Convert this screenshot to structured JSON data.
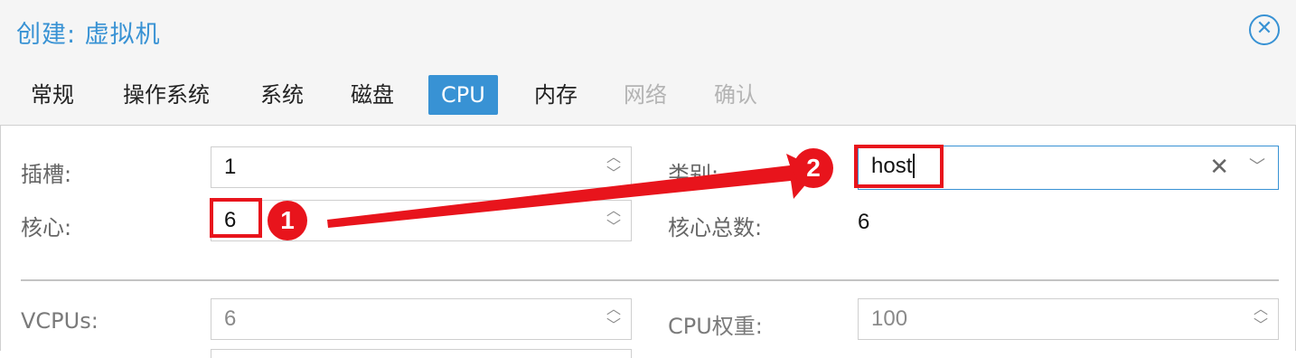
{
  "window": {
    "title": "创建: 虚拟机"
  },
  "tabs": [
    {
      "label": "常规",
      "state": "normal"
    },
    {
      "label": "操作系统",
      "state": "normal"
    },
    {
      "label": "系统",
      "state": "normal"
    },
    {
      "label": "磁盘",
      "state": "normal"
    },
    {
      "label": "CPU",
      "state": "active"
    },
    {
      "label": "内存",
      "state": "normal"
    },
    {
      "label": "网络",
      "state": "disabled"
    },
    {
      "label": "确认",
      "state": "disabled"
    }
  ],
  "cpu": {
    "sockets": {
      "label": "插槽:",
      "value": "1"
    },
    "cores": {
      "label": "核心:",
      "value": "6"
    },
    "type": {
      "label": "类别:",
      "value": "host"
    },
    "total_cores": {
      "label": "核心总数:",
      "value": "6"
    },
    "vcpus": {
      "label": "VCPUs:",
      "value": "6"
    },
    "cpu_weight": {
      "label": "CPU权重:",
      "value": "100"
    }
  },
  "annotations": {
    "badge1": "1",
    "badge2": "2"
  },
  "colors": {
    "accent": "#3892d4",
    "highlight": "#e8141c"
  },
  "icons": {
    "close": "close-circle-icon",
    "spinner": "up-down-chevron-icon",
    "clear": "clear-x-icon",
    "dropdown": "chevron-down-icon"
  }
}
